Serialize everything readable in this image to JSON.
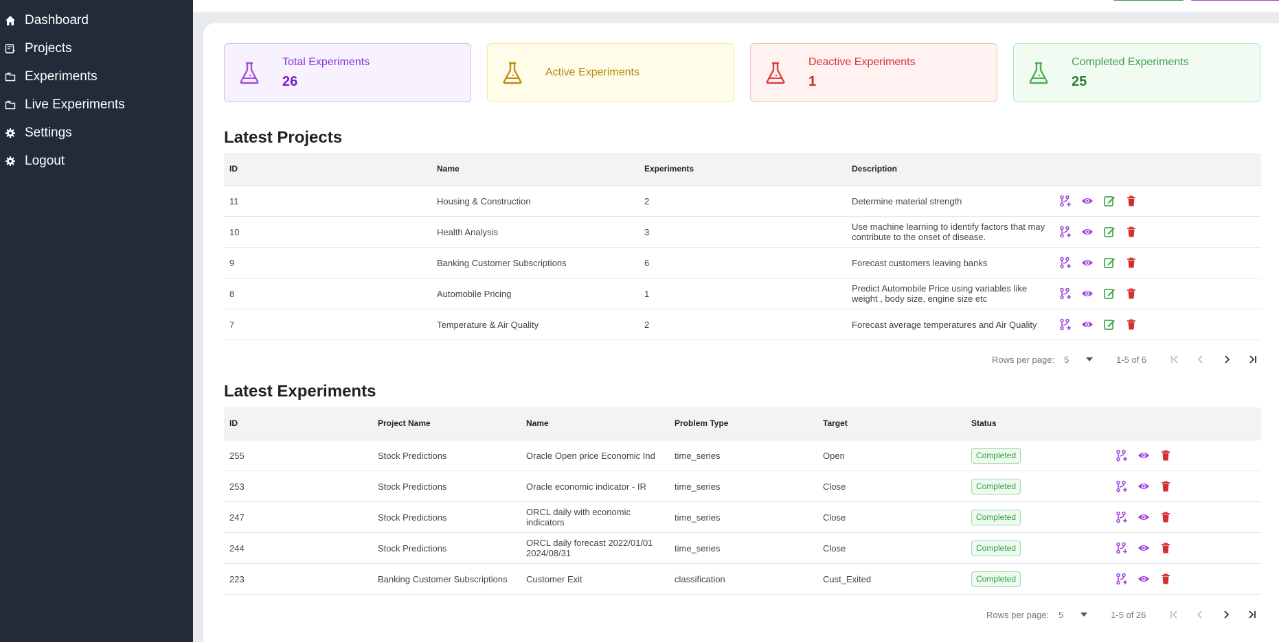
{
  "sidebar": {
    "items": [
      {
        "label": "Dashboard"
      },
      {
        "label": "Projects"
      },
      {
        "label": "Experiments"
      },
      {
        "label": "Live Experiments"
      },
      {
        "label": "Settings"
      },
      {
        "label": "Logout"
      }
    ]
  },
  "stats": [
    {
      "title": "Total Experiments",
      "value": "26",
      "color": "#8a2be2",
      "bg": "#f8f2ff",
      "border": "#d8b9f4"
    },
    {
      "title": "Active Experiments",
      "value": "",
      "color": "#b8860b",
      "bg": "#fffde9",
      "border": "#f1e7a9"
    },
    {
      "title": "Deactive Experiments",
      "value": "1",
      "color": "#d32f2f",
      "bg": "#fff2f1",
      "border": "#f3bcbc"
    },
    {
      "title": "Completed Experiments",
      "value": "25",
      "color": "#43a047",
      "bg": "#f0fbf2",
      "border": "#b8e6c0"
    }
  ],
  "projects": {
    "title": "Latest Projects",
    "columns": [
      "ID",
      "Name",
      "Experiments",
      "Description"
    ],
    "rows": [
      {
        "id": "11",
        "name": "Housing & Construction",
        "experiments": "2",
        "description": "Determine material strength"
      },
      {
        "id": "10",
        "name": "Health Analysis",
        "experiments": "3",
        "description": "Use machine learning to identify factors that may contribute to the onset of disease."
      },
      {
        "id": "9",
        "name": "Banking Customer Subscriptions",
        "experiments": "6",
        "description": "Forecast customers leaving banks"
      },
      {
        "id": "8",
        "name": "Automobile Pricing",
        "experiments": "1",
        "description": "Predict Automobile Price using variables like weight , body size, engine size etc"
      },
      {
        "id": "7",
        "name": "Temperature & Air Quality",
        "experiments": "2",
        "description": "Forecast average temperatures and Air Quality"
      }
    ],
    "pager": {
      "rows_label": "Rows per page:",
      "rows_value": "5",
      "range": "1-5 of 6"
    }
  },
  "experiments": {
    "title": "Latest Experiments",
    "columns": [
      "ID",
      "Project Name",
      "Name",
      "Problem Type",
      "Target",
      "Status"
    ],
    "rows": [
      {
        "id": "255",
        "project": "Stock Predictions",
        "name": "Oracle Open price Economic Ind",
        "type": "time_series",
        "target": "Open",
        "status": "Completed"
      },
      {
        "id": "253",
        "project": "Stock Predictions",
        "name": "Oracle economic indicator - IR",
        "type": "time_series",
        "target": "Close",
        "status": "Completed"
      },
      {
        "id": "247",
        "project": "Stock Predictions",
        "name": "ORCL daily with economic indicators",
        "type": "time_series",
        "target": "Close",
        "status": "Completed"
      },
      {
        "id": "244",
        "project": "Stock Predictions",
        "name": "ORCL daily forecast 2022/01/01 2024/08/31",
        "type": "time_series",
        "target": "Close",
        "status": "Completed"
      },
      {
        "id": "223",
        "project": "Banking Customer Subscriptions",
        "name": "Customer Exit",
        "type": "classification",
        "target": "Cust_Exited",
        "status": "Completed"
      }
    ],
    "pager": {
      "rows_label": "Rows per page:",
      "rows_value": "5",
      "range": "1-5 of 26"
    }
  },
  "colors": {
    "purple": "#8a2be2",
    "green": "#43a047",
    "red": "#d32f2f",
    "sidebar": "#222b38"
  }
}
